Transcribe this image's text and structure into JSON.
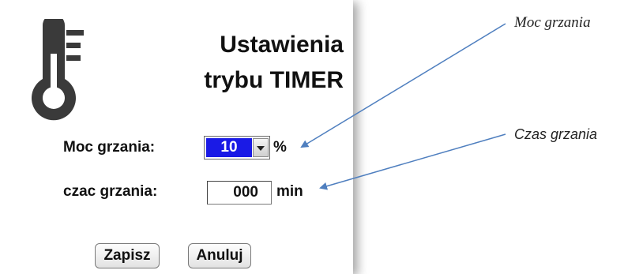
{
  "title": {
    "line1": "Ustawienia",
    "line2": "trybu TIMER"
  },
  "form": {
    "power_label": "Moc grzania:",
    "power_value": "10",
    "power_unit": "%",
    "time_label": "czac grzania:",
    "time_value": "000",
    "time_unit": "min"
  },
  "buttons": {
    "save": "Zapisz",
    "cancel": "Anuluj"
  },
  "annotations": {
    "power": "Moc grzania",
    "time": "Czas grzania"
  },
  "icons": {
    "thermometer": "thermometer-icon",
    "dropdown": "chevron-down-icon"
  },
  "colors": {
    "selected_value_bg": "#1a1ae6",
    "arrow": "#4f7fbf",
    "icon": "#3a3a3a"
  }
}
